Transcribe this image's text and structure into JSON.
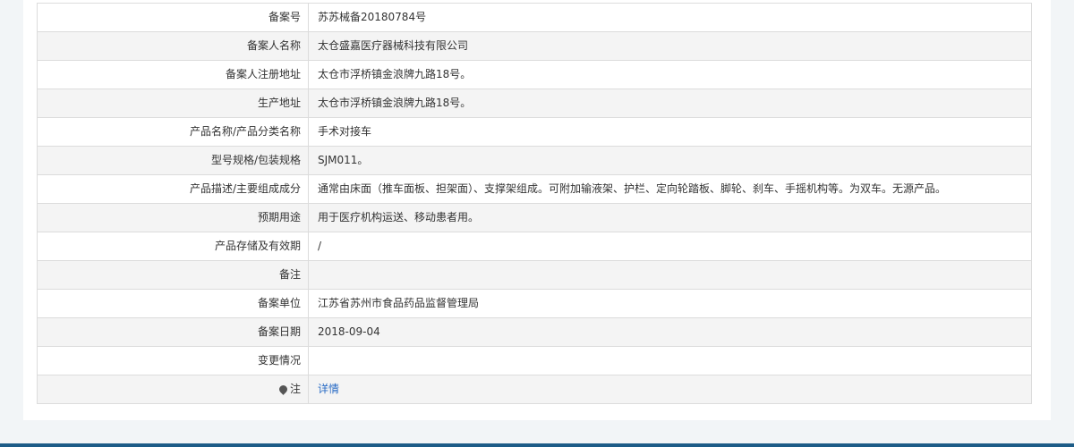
{
  "record": {
    "rows": [
      {
        "label": "备案号",
        "value": "苏苏械备20180784号"
      },
      {
        "label": "备案人名称",
        "value": "太仓盛嘉医疗器械科技有限公司"
      },
      {
        "label": "备案人注册地址",
        "value": "太仓市浮桥镇金浪牌九路18号。"
      },
      {
        "label": "生产地址",
        "value": "太仓市浮桥镇金浪牌九路18号。"
      },
      {
        "label": "产品名称/产品分类名称",
        "value": "手术对接车"
      },
      {
        "label": "型号规格/包装规格",
        "value": "SJM011。"
      },
      {
        "label": "产品描述/主要组成成分",
        "value": "通常由床面（推车面板、担架面）、支撑架组成。可附加输液架、护栏、定向轮踏板、脚轮、刹车、手摇机构等。为双车。无源产品。"
      },
      {
        "label": "预期用途",
        "value": "用于医疗机构运送、移动患者用。"
      },
      {
        "label": "产品存储及有效期",
        "value": "/"
      },
      {
        "label": "备注",
        "value": ""
      },
      {
        "label": "备案单位",
        "value": "江苏省苏州市食品药品监督管理局"
      },
      {
        "label": "备案日期",
        "value": "2018-09-04"
      },
      {
        "label": "变更情况",
        "value": ""
      }
    ],
    "note": {
      "label": "注",
      "icon": "location-pin-icon",
      "link": "详情"
    }
  }
}
